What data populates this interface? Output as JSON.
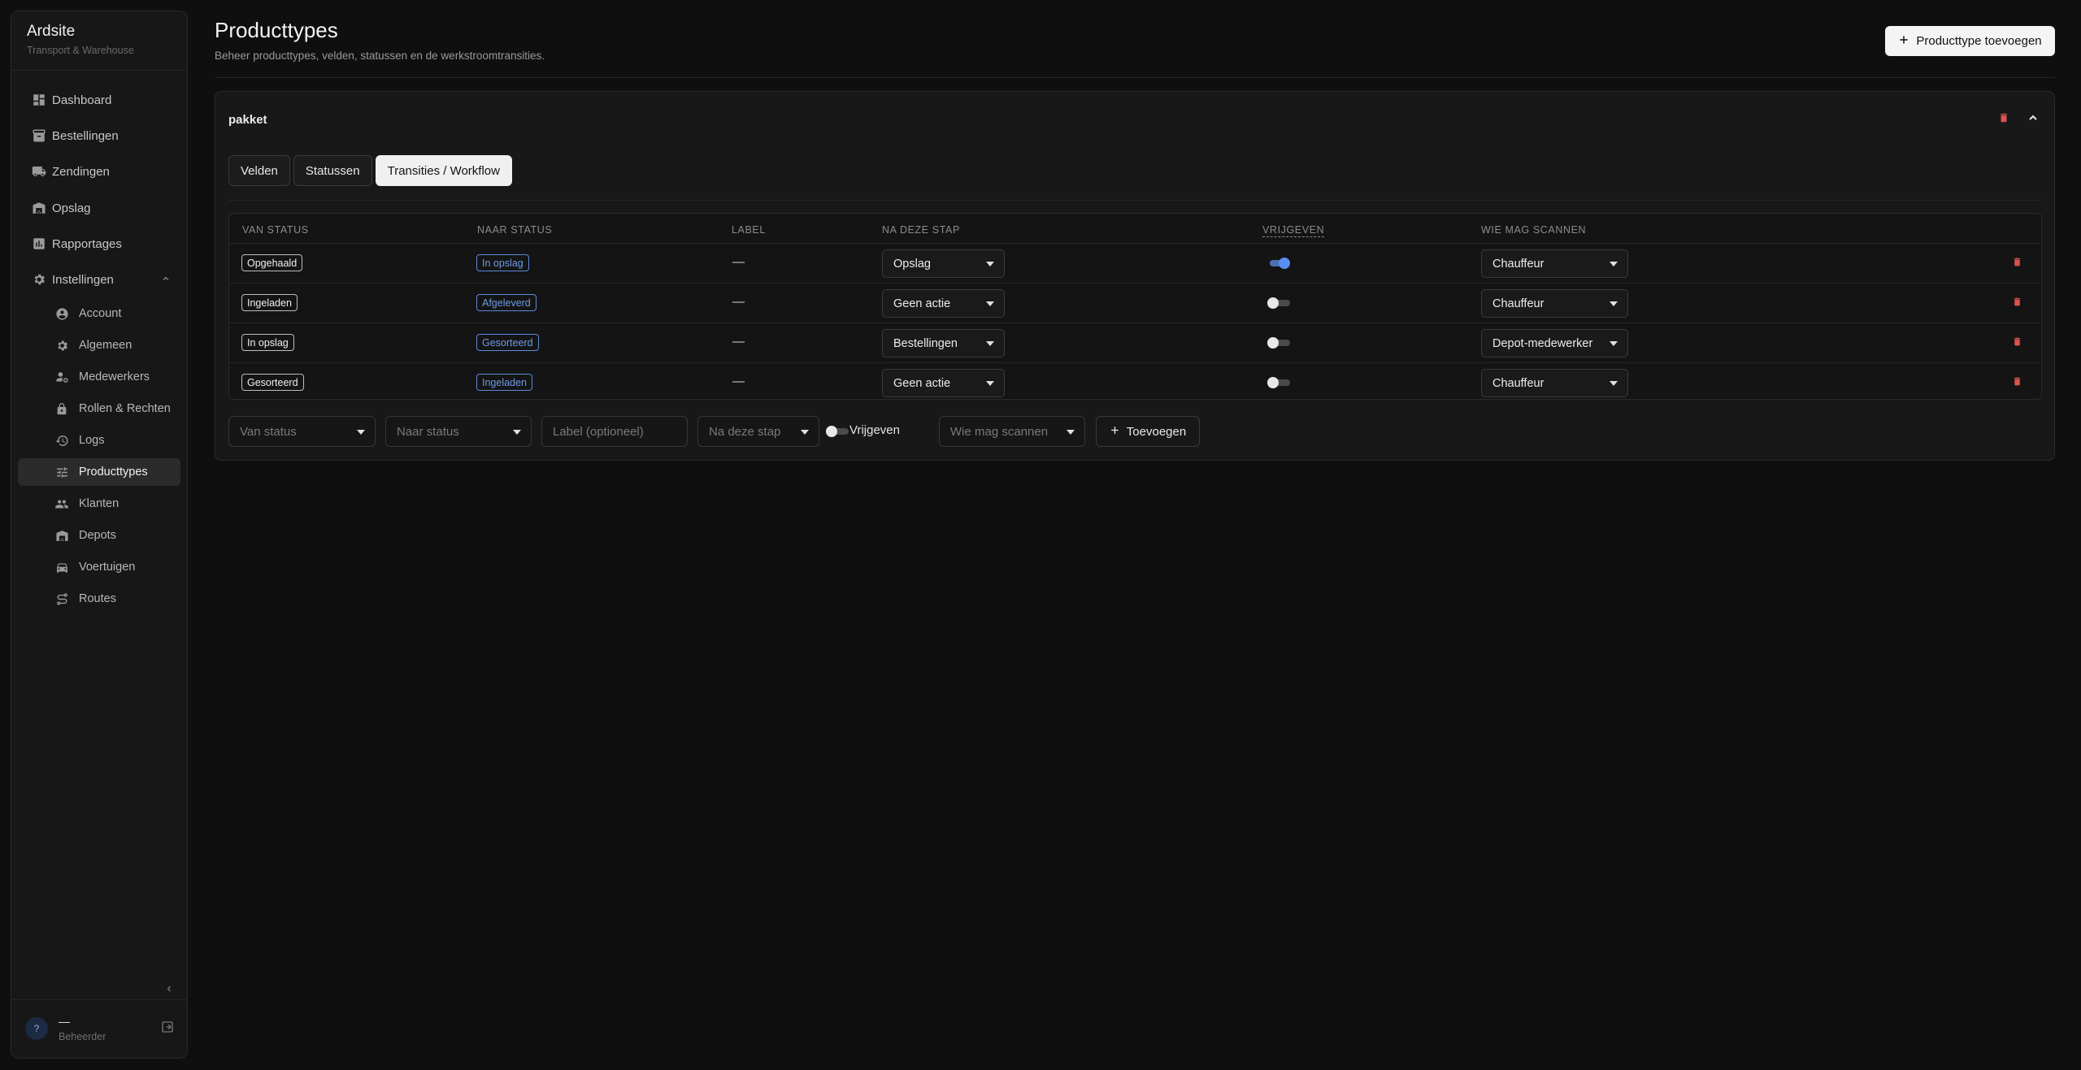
{
  "app": {
    "name": "Ardsite",
    "subtitle": "Transport & Warehouse"
  },
  "sidebar": {
    "items": [
      {
        "label": "Dashboard",
        "icon": "dashboard-icon"
      },
      {
        "label": "Bestellingen",
        "icon": "archive-icon"
      },
      {
        "label": "Zendingen",
        "icon": "truck-icon"
      },
      {
        "label": "Opslag",
        "icon": "warehouse-icon"
      },
      {
        "label": "Rapportages",
        "icon": "bar-chart-icon"
      },
      {
        "label": "Instellingen",
        "icon": "gear-icon",
        "expanded": true
      }
    ],
    "sub_items": [
      {
        "label": "Account",
        "icon": "account-circle-icon"
      },
      {
        "label": "Algemeen",
        "icon": "gear-icon"
      },
      {
        "label": "Medewerkers",
        "icon": "person-gear-icon"
      },
      {
        "label": "Rollen & Rechten",
        "icon": "lock-icon"
      },
      {
        "label": "Logs",
        "icon": "history-icon"
      },
      {
        "label": "Producttypes",
        "icon": "tune-icon",
        "active": true
      },
      {
        "label": "Klanten",
        "icon": "people-icon"
      },
      {
        "label": "Depots",
        "icon": "warehouse-icon"
      },
      {
        "label": "Voertuigen",
        "icon": "car-icon"
      },
      {
        "label": "Routes",
        "icon": "route-icon"
      }
    ],
    "user": {
      "initial": "?",
      "name": "—",
      "role": "Beheerder"
    }
  },
  "header": {
    "title": "Producttypes",
    "subtitle": "Beheer producttypes, velden, statussen en de werkstroomtransities.",
    "add_button": "Producttype toevoegen"
  },
  "card": {
    "title": "pakket",
    "tabs": [
      "Velden",
      "Statussen",
      "Transities / Workflow"
    ],
    "active_tab": "Transities / Workflow",
    "columns": [
      "Van status",
      "Naar status",
      "Label",
      "Na deze stap",
      "Vrijgeven",
      "Wie mag scannen"
    ],
    "rows": [
      {
        "from": "Opgehaald",
        "to": "In opslag",
        "label": "—",
        "next_step": "Opslag",
        "release": true,
        "scanner": "Chauffeur"
      },
      {
        "from": "Ingeladen",
        "to": "Afgeleverd",
        "label": "—",
        "next_step": "Geen actie",
        "release": false,
        "scanner": "Chauffeur"
      },
      {
        "from": "In opslag",
        "to": "Gesorteerd",
        "label": "—",
        "next_step": "Bestellingen",
        "release": false,
        "scanner": "Depot-medewerker"
      },
      {
        "from": "Gesorteerd",
        "to": "Ingeladen",
        "label": "—",
        "next_step": "Geen actie",
        "release": false,
        "scanner": "Chauffeur"
      }
    ],
    "add_row": {
      "from_placeholder": "Van status",
      "to_placeholder": "Naar status",
      "label_placeholder": "Label (optioneel)",
      "next_placeholder": "Na deze stap",
      "release_label": "Vrijgeven",
      "scanner_placeholder": "Wie mag scannen",
      "add_button": "Toevoegen"
    }
  },
  "colors": {
    "accent": "#5b8ef0",
    "danger": "#d9534f",
    "status_blue": "#6f9be3"
  }
}
